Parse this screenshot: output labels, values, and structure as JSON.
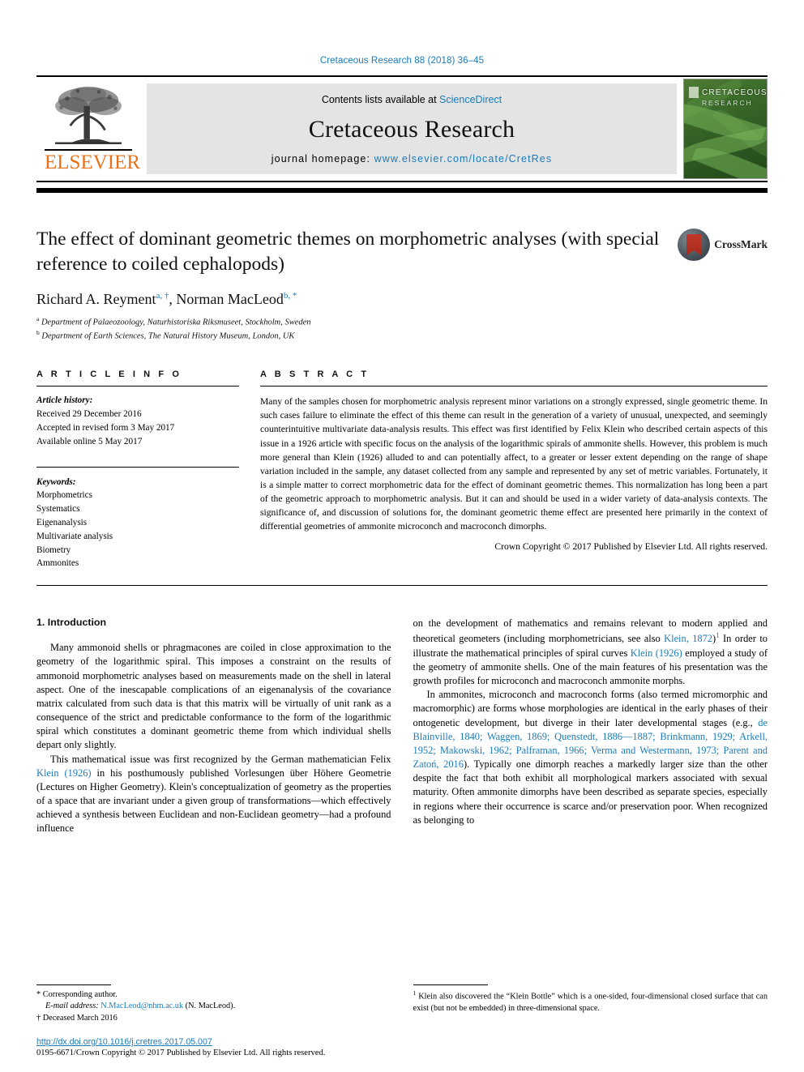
{
  "running_head": "Cretaceous Research 88 (2018) 36–45",
  "masthead": {
    "publisher_name": "ELSEVIER",
    "contents_prefix": "Contents lists available at ",
    "contents_link": "ScienceDirect",
    "journal_name": "Cretaceous Research",
    "homepage_prefix": "journal homepage: ",
    "homepage_url": "www.elsevier.com/locate/CretRes",
    "cover_title_line1": "CRETACEOUS",
    "cover_title_line2": "RESEARCH"
  },
  "article": {
    "title": "The effect of dominant geometric themes on morphometric analyses (with special reference to coiled cephalopods)",
    "authors": "Richard A. Reyment , Norman MacLeod",
    "author1_name": "Richard A. Reyment",
    "author1_marks": "a, †",
    "author2_name": "Norman MacLeod",
    "author2_marks": "b, *",
    "affiliation_a_mark": "a",
    "affiliation_a": "Department of Palaeozoology, Naturhistoriska Riksmuseet, Stockholm, Sweden",
    "affiliation_b_mark": "b",
    "affiliation_b": "Department of Earth Sciences, The Natural History Museum, London, UK",
    "crossmark_label": "CrossMark"
  },
  "info": {
    "heading": "A R T I C L E  I N F O",
    "history_label": "Article history:",
    "history": [
      "Received 29 December 2016",
      "Accepted in revised form 3 May 2017",
      "Available online 5 May 2017"
    ],
    "keywords_label": "Keywords:",
    "keywords": [
      "Morphometrics",
      "Systematics",
      "Eigenanalysis",
      "Multivariate analysis",
      "Biometry",
      "Ammonites"
    ]
  },
  "abstract": {
    "heading": "A B S T R A C T",
    "text": "Many of the samples chosen for morphometric analysis represent minor variations on a strongly expressed, single geometric theme. In such cases failure to eliminate the effect of this theme can result in the generation of a variety of unusual, unexpected, and seemingly counterintuitive multivariate data-analysis results. This effect was first identified by Felix Klein who described certain aspects of this issue in a 1926 article with specific focus on the analysis of the logarithmic spirals of ammonite shells. However, this problem is much more general than Klein (1926) alluded to and can potentially affect, to a greater or lesser extent depending on the range of shape variation included in the sample, any dataset collected from any sample and represented by any set of metric variables. Fortunately, it is a simple matter to correct morphometric data for the effect of dominant geometric themes. This normalization has long been a part of the geometric approach to morphometric analysis. But it can and should be used in a wider variety of data-analysis contexts. The significance of, and discussion of solutions for, the dominant geometric theme effect are presented here primarily in the context of differential geometries of ammonite microconch and macroconch dimorphs.",
    "copyright": "Crown Copyright © 2017 Published by Elsevier Ltd. All rights reserved."
  },
  "body": {
    "section_heading": "1. Introduction",
    "left_p1": "Many ammonoid shells or phragmacones are coiled in close approximation to the geometry of the logarithmic spiral. This imposes a constraint on the results of ammonoid morphometric analyses based on measurements made on the shell in lateral aspect. One of the inescapable complications of an eigenanalysis of the covariance matrix calculated from such data is that this matrix will be virtually of unit rank as a consequence of the strict and predictable conformance to the form of the logarithmic spiral which constitutes a dominant geometric theme from which individual shells depart only slightly.",
    "left_p2_a": "This mathematical issue was first recognized by the German mathematician Felix ",
    "left_p2_link": "Klein (1926)",
    "left_p2_b": " in his posthumously published Vorlesungen über Höhere Geometrie (Lectures on Higher Geometry). Klein's conceptualization of geometry as the properties of a space that are invariant under a given group of transformations—which effectively achieved a synthesis between Euclidean and non-Euclidean geometry—had a profound influence",
    "right_p1_a": "on the development of mathematics and remains relevant to modern applied and theoretical geometers (including morphometricians, see also ",
    "right_p1_link1": "Klein, 1872",
    "right_p1_b": ")",
    "right_p1_fnmark": "1",
    "right_p1_c": " In order to illustrate the mathematical principles of spiral curves ",
    "right_p1_link2": "Klein (1926)",
    "right_p1_d": " employed a study of the geometry of ammonite shells. One of the main features of his presentation was the growth profiles for microconch and macroconch ammonite morphs.",
    "right_p2_a": "In ammonites, microconch and macroconch forms (also termed micromorphic and macromorphic) are forms whose morphologies are identical in the early phases of their ontogenetic development, but diverge in their later developmental stages (e.g., ",
    "right_p2_links": "de Blainville, 1840; Waggen, 1869; Quenstedt, 1886—1887; Brinkmann, 1929; Arkell, 1952; Makowski, 1962; Palframan, 1966; Verma and Westermann, 1973; Parent and Zatoń, 2016",
    "right_p2_b": "). Typically one dimorph reaches a markedly larger size than the other despite the fact that both exhibit all morphological markers associated with sexual maturity. Often ammonite dimorphs have been described as separate species, especially in regions where their occurrence is scarce and/or preservation poor. When recognized as belonging to"
  },
  "footnotes": {
    "corresponding_mark": "*",
    "corresponding_text": "Corresponding author.",
    "email_label": "E-mail address:",
    "email": "N.MacLeod@nhm.ac.uk",
    "email_suffix": " (N. MacLeod).",
    "deceased_mark": "†",
    "deceased_text": "Deceased March 2016",
    "right_mark": "1",
    "right_text": "Klein also discovered the “Klein Bottle” which is a one-sided, four-dimensional closed surface that can exist (but not be embedded) in three-dimensional space."
  },
  "bottom": {
    "doi": "http://dx.doi.org/10.1016/j.cretres.2017.05.007",
    "issn_line": "0195-6671/Crown Copyright © 2017 Published by Elsevier Ltd. All rights reserved."
  },
  "colors": {
    "link_blue": "#1a7bb9",
    "elsevier_orange": "#e8711a",
    "band_gray": "#e4e4e4"
  }
}
